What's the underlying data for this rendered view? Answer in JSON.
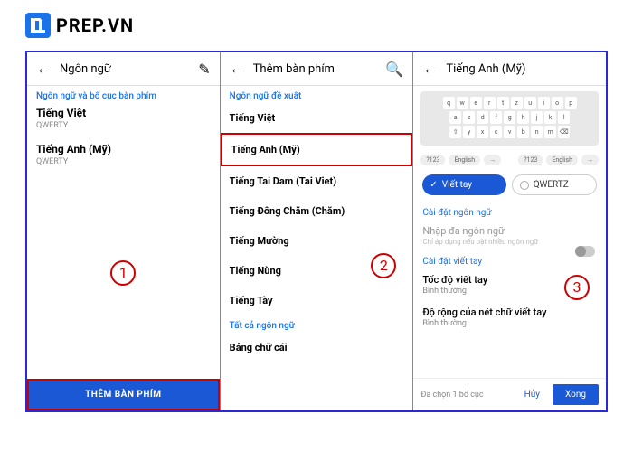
{
  "logo": {
    "text": "PREP.VN"
  },
  "panel1": {
    "title": "Ngôn ngữ",
    "section": "Ngôn ngữ và bố cục bàn phím",
    "langs": [
      {
        "name": "Tiếng Việt",
        "sub": "QWERTY"
      },
      {
        "name": "Tiếng Anh (Mỹ)",
        "sub": "QWERTY"
      }
    ],
    "button": "THÊM BÀN PHÍM",
    "step": "1"
  },
  "panel2": {
    "title": "Thêm bàn phím",
    "section": "Ngôn ngữ đề xuất",
    "items": [
      "Tiếng Việt",
      "Tiếng Anh (Mỹ)",
      "Tiếng Tai Dam (Tai Viet)",
      "Tiếng Đông Chăm (Chăm)",
      "Tiếng Mường",
      "Tiếng Nùng",
      "Tiếng Tày"
    ],
    "all_section": "Tất cả ngôn ngữ",
    "all_item": "Bảng chữ cái",
    "step": "2"
  },
  "panel3": {
    "title": "Tiếng Anh (Mỹ)",
    "chip_selected": "Viết tay",
    "chip_other": "QWERTZ",
    "lang_settings": "Cài đặt ngôn ngữ",
    "multi_title": "Nhập đa ngôn ngữ",
    "multi_sub": "Chỉ áp dụng nếu bật nhiều ngôn ngữ",
    "hw_settings": "Cài đặt viết tay",
    "speed_title": "Tốc độ viết tay",
    "speed_sub": "Bình thường",
    "width_title": "Độ rộng của nét chữ viết tay",
    "width_sub": "Bình thường",
    "footer_text": "Đã chọn 1 bố cục",
    "cancel": "Hủy",
    "done": "Xong",
    "step": "3"
  }
}
